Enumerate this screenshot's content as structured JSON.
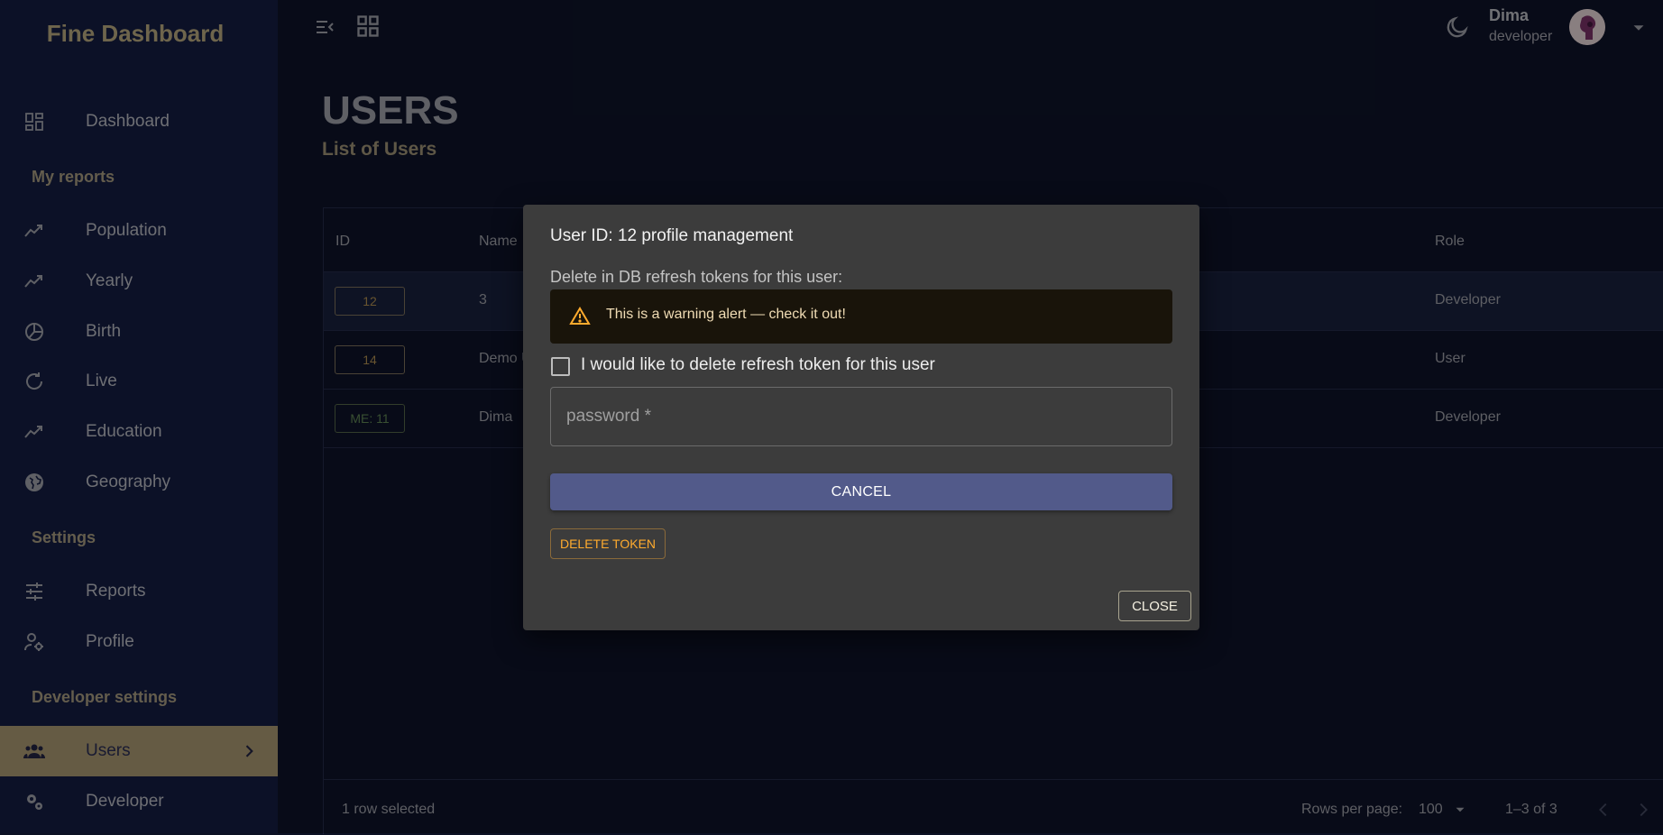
{
  "sidebar": {
    "brand": "Fine Dashboard",
    "items": {
      "dashboard": "Dashboard",
      "population": "Population",
      "yearly": "Yearly",
      "birth": "Birth",
      "live": "Live",
      "education": "Education",
      "geography": "Geography",
      "reports": "Reports",
      "profile": "Profile",
      "users": "Users",
      "developer": "Developer"
    },
    "sections": {
      "my_reports": "My reports",
      "settings": "Settings",
      "developer_settings": "Developer settings"
    }
  },
  "topbar": {
    "icons": [
      "menu-collapse-icon",
      "grid-icon",
      "moon-icon",
      "arrow-drop-down-icon"
    ],
    "user_name": "Dima",
    "user_role": "developer"
  },
  "page": {
    "title": "USERS",
    "subtitle": "List of Users"
  },
  "table": {
    "columns": {
      "id": "ID",
      "name": "Name",
      "role": "Role"
    },
    "rows": [
      {
        "id": "12",
        "name": "3",
        "role": "Developer",
        "selected": true
      },
      {
        "id": "14",
        "name": "Demo U",
        "role": "User",
        "selected": false
      },
      {
        "id": "ME: 11",
        "name": "Dima",
        "role": "Developer",
        "selected": false
      }
    ],
    "footer": {
      "selected": "1 row selected",
      "rows_per_page_label": "Rows per page:",
      "rows_per_page_value": "100",
      "range": "1–3 of 3"
    }
  },
  "modal": {
    "title": "User ID: 12 profile management",
    "label": "Delete in DB refresh tokens for this user:",
    "alert": "This is a warning alert — check it out!",
    "checkbox_label": "I would like to delete refresh token for this user",
    "password_label": "password *",
    "cancel": "CANCEL",
    "delete_token": "DELETE TOKEN",
    "close": "CLOSE"
  },
  "colors": {
    "background": "#0c1124",
    "sidebar": "#121a3a",
    "accent": "#958665",
    "modal": "#3c3c3c",
    "primary_button": "#525a8a",
    "warning": "#ffab2e"
  }
}
